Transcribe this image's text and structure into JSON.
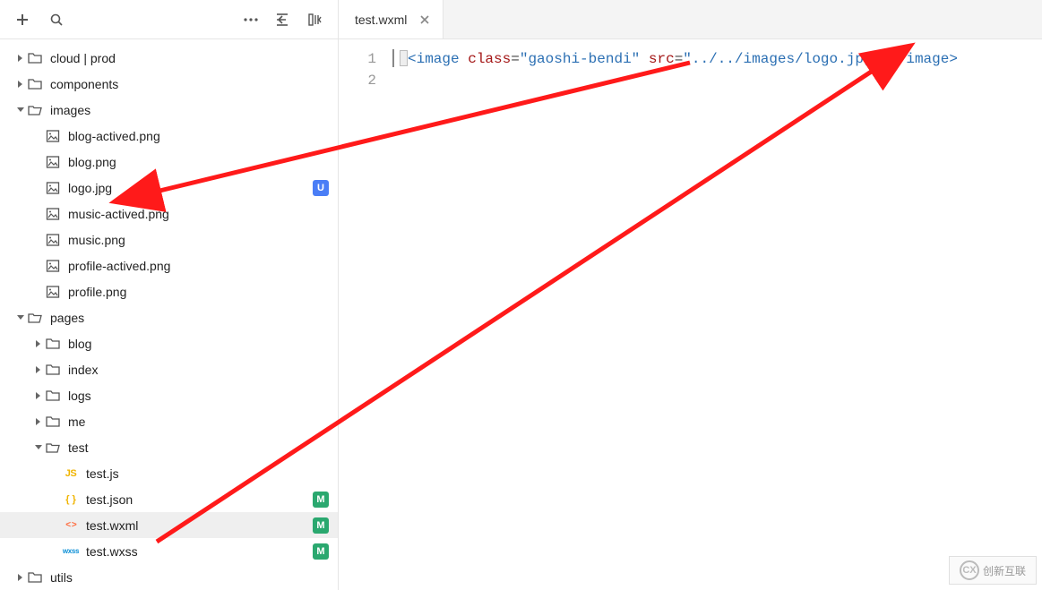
{
  "toolbar": {
    "actions": {
      "add": "+",
      "search": "search",
      "more": "…",
      "collapse": "collapse",
      "layout": "layout"
    }
  },
  "tree": {
    "cloud": "cloud | prod",
    "components": "components",
    "images": {
      "label": "images",
      "files": {
        "blog_actived": "blog-actived.png",
        "blog": "blog.png",
        "logo": "logo.jpg",
        "music_actived": "music-actived.png",
        "music": "music.png",
        "profile_actived": "profile-actived.png",
        "profile": "profile.png"
      }
    },
    "pages": {
      "label": "pages",
      "blog": "blog",
      "index": "index",
      "logs": "logs",
      "me": "me",
      "test": {
        "label": "test",
        "js": "test.js",
        "json": "test.json",
        "wxml": "test.wxml",
        "wxss": "test.wxss"
      }
    },
    "utils": "utils"
  },
  "badges": {
    "u": "U",
    "m": "M"
  },
  "file_icons": {
    "js": "JS",
    "json": "{ }",
    "wxml": "< >",
    "wxss": "wxss"
  },
  "tabs": {
    "active": {
      "label": "test.wxml"
    }
  },
  "editor": {
    "line_numbers": [
      "1",
      "2"
    ],
    "code": {
      "tag_open": "<image",
      "attr_class_name": "class",
      "attr_class_val": "\"gaoshi-bendi\"",
      "attr_src_name": "src",
      "attr_src_val": "\"../../images/logo.jpg\"",
      "tag_close": "</image>"
    }
  },
  "watermark": {
    "text": "创新互联",
    "logo": "CX"
  }
}
